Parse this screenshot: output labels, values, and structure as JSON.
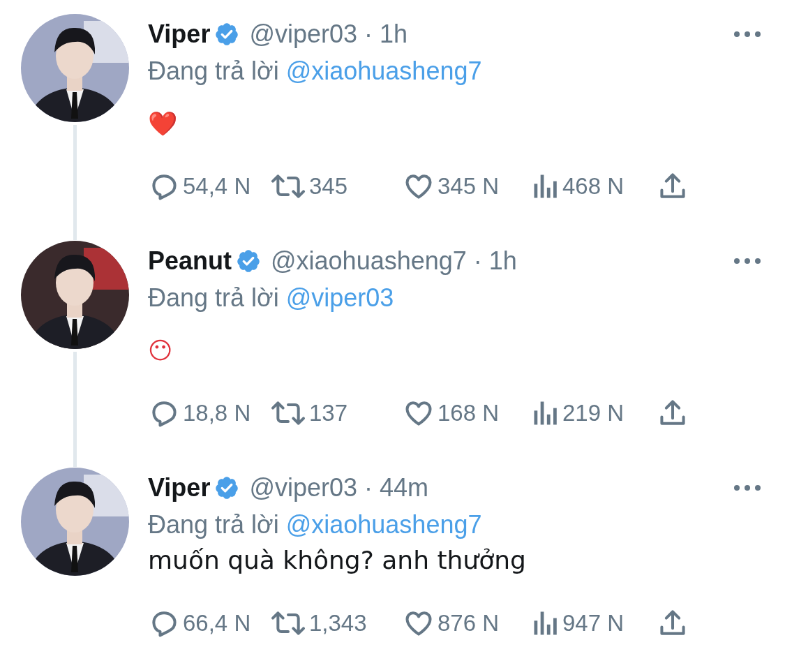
{
  "tweets": [
    {
      "name": "Viper",
      "verified": true,
      "handle": "@viper03",
      "time": "· 1h",
      "reply_prefix": "Đang trả lời",
      "reply_to": "@xiaohuasheng7",
      "body": {
        "kind": "emoji",
        "text": "❤️"
      },
      "replies": "54,4 N",
      "retweets": "345",
      "likes": "345 N",
      "views": "468 N"
    },
    {
      "name": "Peanut",
      "verified": true,
      "handle": "@xiaohuasheng7",
      "time": "· 1h",
      "reply_prefix": "Đang trả lời",
      "reply_to": "@viper03",
      "body": {
        "kind": "emoji",
        "text": "😶"
      },
      "replies": "18,8 N",
      "retweets": "137",
      "likes": "168 N",
      "views": "219 N"
    },
    {
      "name": "Viper",
      "verified": true,
      "handle": "@viper03",
      "time": "· 44m",
      "reply_prefix": "Đang trả lời",
      "reply_to": "@xiaohuasheng7",
      "body": {
        "kind": "text",
        "text": "muốn quà không? anh thưởng"
      },
      "replies": "66,4 N",
      "retweets": "1,343",
      "likes": "876 N",
      "views": "947 N"
    }
  ]
}
